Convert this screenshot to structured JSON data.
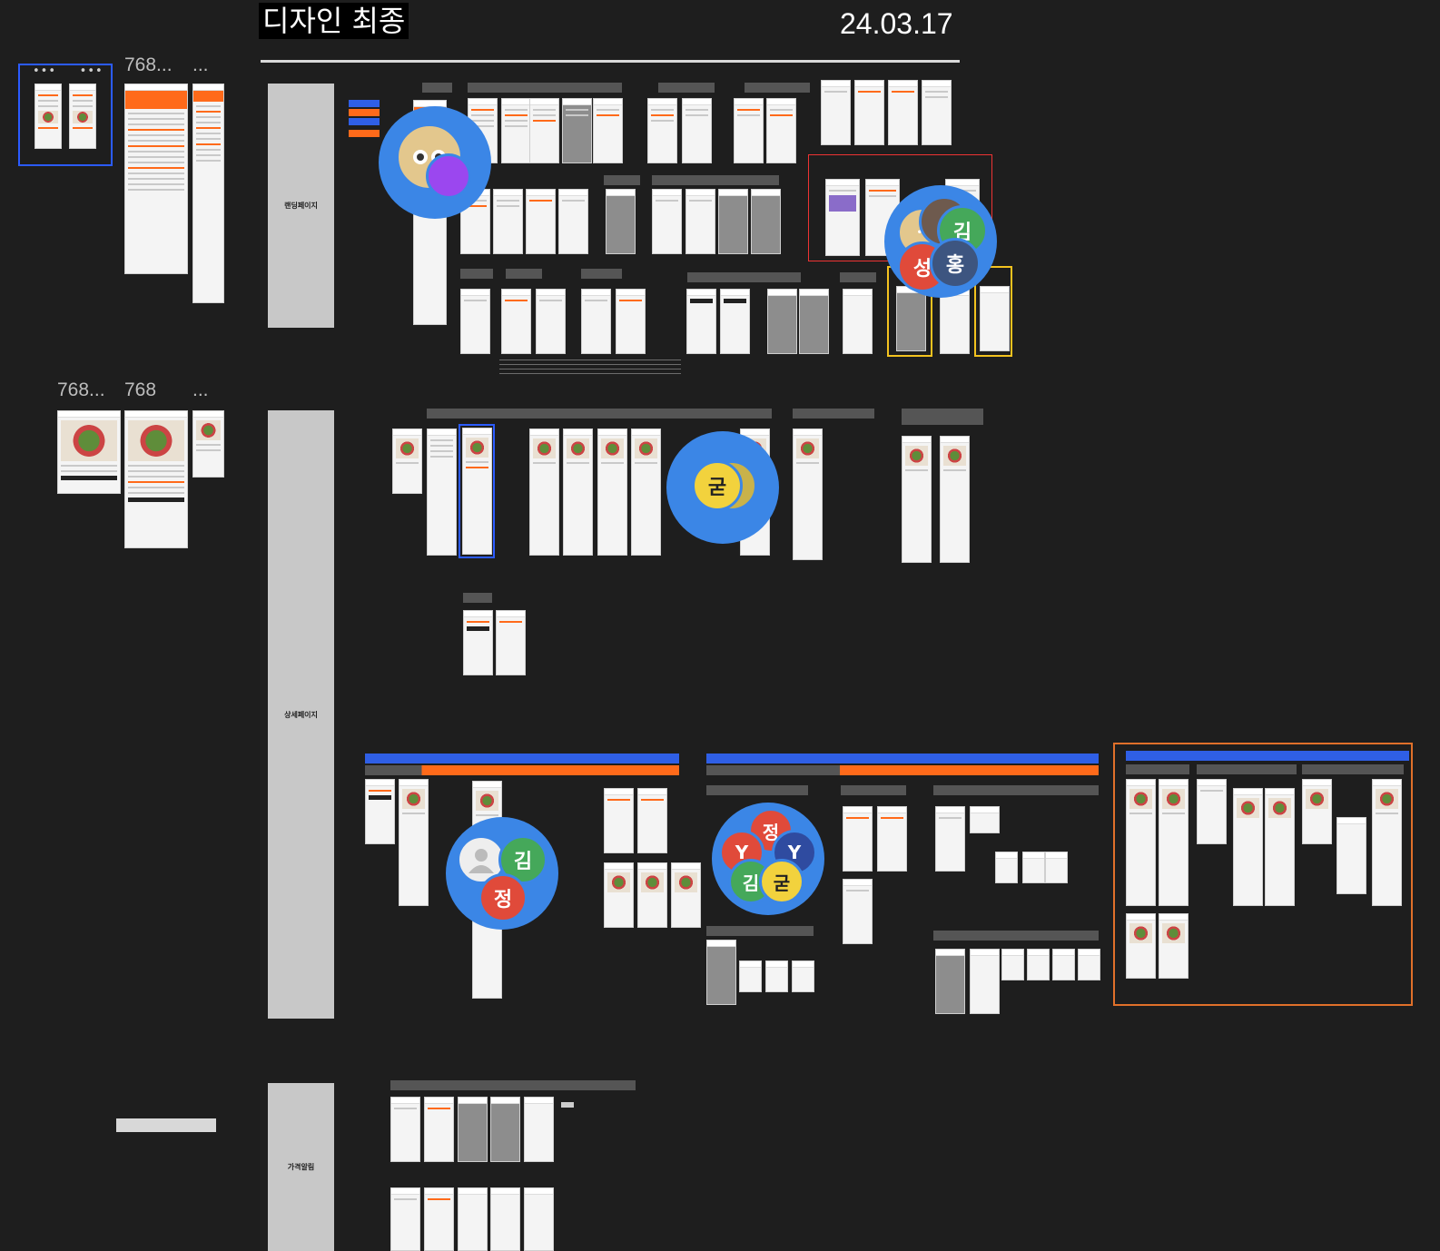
{
  "header": {
    "title": "디자인 최종",
    "date": "24.03.17"
  },
  "page_labels": {
    "frame_768_a": "768...",
    "frame_768_b": "768...",
    "frame_768_c": "768",
    "more": "..."
  },
  "sections": [
    {
      "name": "랜딩페이지"
    },
    {
      "name": "상세페이지"
    },
    {
      "name": "가격알림"
    }
  ],
  "collaborators": {
    "group1": [
      "avatar-face",
      "purple"
    ],
    "group2": [
      "김",
      "성",
      "홍"
    ],
    "group3": [
      "굳"
    ],
    "group4": [
      "김",
      "정"
    ],
    "group5": [
      "정",
      "Y",
      "Y",
      "김",
      "굳"
    ]
  },
  "colors": {
    "accent": "#ff6a1a",
    "blue": "#2f5fe6",
    "canvas": "#1e1e1e",
    "cursor": "#3b86e6"
  }
}
